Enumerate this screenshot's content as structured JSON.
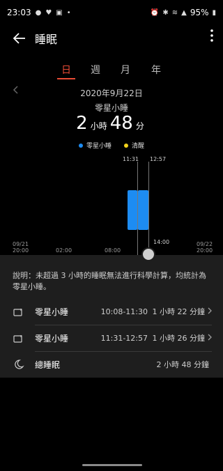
{
  "status_bar": {
    "time": "23:03",
    "battery": "95%"
  },
  "header": {
    "title": "睡眠"
  },
  "tabs": [
    {
      "label": "日"
    },
    {
      "label": "週"
    },
    {
      "label": "月"
    },
    {
      "label": "年"
    }
  ],
  "summary": {
    "date": "2020年9月22日",
    "type": "零星小睡",
    "hours": "2",
    "hours_unit": "小時",
    "minutes": "48",
    "minutes_unit": "分"
  },
  "legend": [
    {
      "label": "零星小睡",
      "color": "#1d8cf2"
    },
    {
      "label": "清醒",
      "color": "#f2d21b"
    }
  ],
  "chart": {
    "selection_start": "11:31",
    "selection_end": "12:57",
    "cursor_time": "14:00",
    "axis_ticks": [
      {
        "label": "09/21\n20:00"
      },
      {
        "label": "02:00"
      },
      {
        "label": "08:00"
      },
      {
        "label": "09/22\n20:00"
      }
    ]
  },
  "details": {
    "note": "說明：未超過 3 小時的睡眠無法進行科學計算，均統計為零星小睡。",
    "rows": [
      {
        "label": "零星小睡",
        "time": "10:08-11:30",
        "duration": "1 小時 22 分鐘"
      },
      {
        "label": "零星小睡",
        "time": "11:31-12:57",
        "duration": "1 小時 26 分鐘"
      }
    ],
    "total": {
      "label": "總睡眠",
      "duration": "2 小時 48 分鐘"
    }
  }
}
